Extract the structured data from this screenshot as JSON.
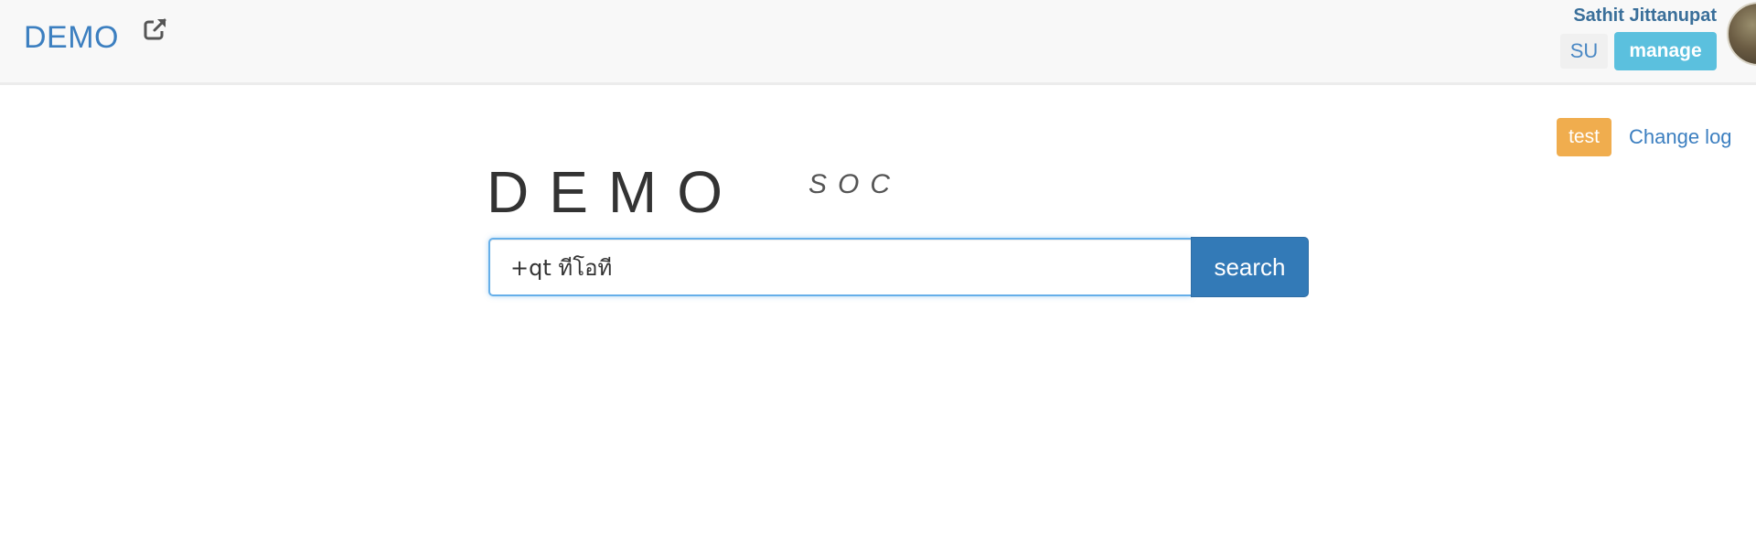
{
  "navbar": {
    "brand": "DEMO",
    "external_link_icon": "external-link-icon"
  },
  "user": {
    "name": "Sathit Jittanupat",
    "su_label": "SU",
    "manage_label": "manage",
    "avatar_icon": "avatar-photo"
  },
  "top_right": {
    "test_label": "test",
    "changelog_label": "Change log"
  },
  "logo": {
    "main": "DEMO",
    "sub": "SOC"
  },
  "search": {
    "value": "+qt ทีโอที",
    "button_label": "search"
  },
  "colors": {
    "link": "#3c7fc0",
    "manage": "#5bc0de",
    "test": "#f0ad4e",
    "primary": "#337ab7"
  }
}
